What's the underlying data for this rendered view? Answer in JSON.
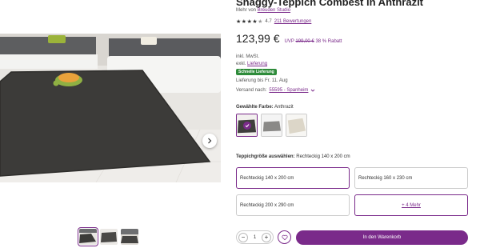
{
  "product": {
    "title": "Shaggy-Teppich Combest in Anthrazit",
    "brand_prefix": "Mehr von",
    "brand": "Breuden Studio",
    "rating": "4.7",
    "rating_value": 4.7,
    "reviews": "211 Bewertungen",
    "price": "123,99 €",
    "uvp_label": "UVP",
    "uvp_price": "199,00 €",
    "discount": "38 % Rabatt",
    "vat": "inkl. MwSt.",
    "shipping_prefix": "exkl.",
    "shipping_link": "Lieferung",
    "fast_badge": "Schnelle Lieferung",
    "delivery": "Lieferung bis Fr. 11. Aug",
    "ship_to_label": "Versand nach:",
    "ship_to_value": "55595 - Spanheim"
  },
  "color": {
    "label": "Gewählte Farbe:",
    "value": "Anthrazit"
  },
  "size": {
    "label": "Teppichgröße auswählen:",
    "value": "Rechteckig 140 x 200 cm",
    "options": [
      "Rechteckig 140 x 200 cm",
      "Rechteckig 160 x 230 cm",
      "Rechteckig 200 x 290 cm"
    ],
    "more": "+ 4 Mehr"
  },
  "cart": {
    "quantity": "1",
    "minus": "−",
    "plus": "+",
    "button": "In den Warenkorb"
  },
  "icons": {
    "next": "chevron-right-icon",
    "wishlist": "heart-icon",
    "ship_dropdown": "chevron-down-icon",
    "selected": "checkmark-icon"
  },
  "colors": {
    "accent": "#7a2a8a",
    "badge": "#2e8b3a",
    "rug": "#3c3b39"
  }
}
